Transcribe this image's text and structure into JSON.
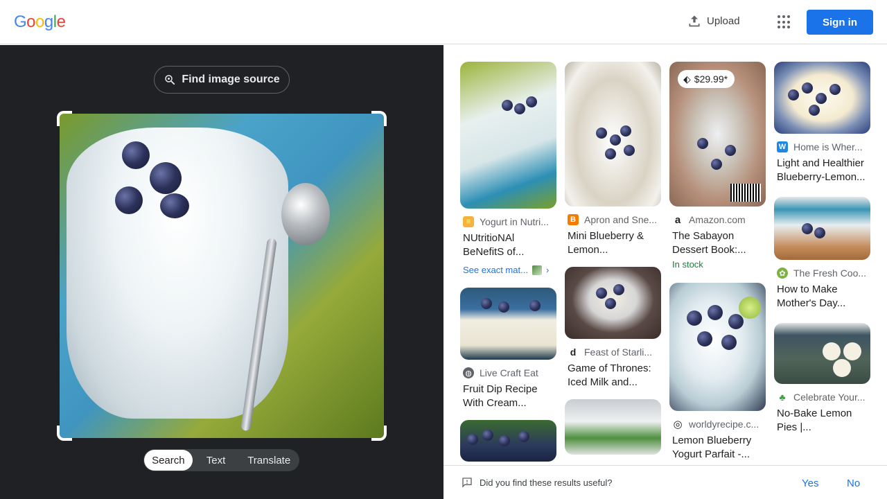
{
  "header": {
    "logo_letters": [
      {
        "ch": "G",
        "color": "#4285F4"
      },
      {
        "ch": "o",
        "color": "#EA4335"
      },
      {
        "ch": "o",
        "color": "#FBBC05"
      },
      {
        "ch": "g",
        "color": "#4285F4"
      },
      {
        "ch": "l",
        "color": "#34A853"
      },
      {
        "ch": "e",
        "color": "#EA4335"
      }
    ],
    "upload_label": "Upload",
    "upload_icon": "upload-icon",
    "apps_icon": "apps-grid-icon",
    "signin_label": "Sign in"
  },
  "left_pane": {
    "find_source_label": "Find image source",
    "find_source_icon": "lens-search-icon",
    "modes": [
      {
        "label": "Search",
        "active": true
      },
      {
        "label": "Text",
        "active": false
      },
      {
        "label": "Translate",
        "active": false
      }
    ]
  },
  "results": {
    "columns": [
      [
        {
          "source": "Yogurt in Nutri...",
          "title": "NUtritioNAl BeNefitS of...",
          "exact_label": "See exact mat...",
          "icon_color": "#f3b33d",
          "icon_char": "≡"
        },
        {
          "source": "Live Craft Eat",
          "title": "Fruit Dip Recipe With Cream...",
          "icon_color": "#5f6368",
          "icon_char": "◍"
        },
        {
          "source": "",
          "title": ""
        }
      ],
      [
        {
          "source": "Apron and Sne...",
          "title": "Mini Blueberry & Lemon...",
          "icon_color": "#f57c00",
          "icon_char": "B"
        },
        {
          "source": "Feast of Starli...",
          "title": "Game of Thrones: Iced Milk and...",
          "icon_color": "#202124",
          "icon_char": "d"
        },
        {
          "source": "",
          "title": ""
        }
      ],
      [
        {
          "source": "Amazon.com",
          "title": "The Sabayon Dessert Book:...",
          "price": "$29.99*",
          "stock": "In stock",
          "icon_color": "#202124",
          "icon_char": "a"
        },
        {
          "source": "worldyrecipe.c...",
          "title": "Lemon Blueberry Yogurt Parfait -...",
          "icon_color": "#202124",
          "icon_char": "◎"
        }
      ],
      [
        {
          "source": "Home is Wher...",
          "title": "Light and Healthier Blueberry-Lemon...",
          "icon_color": "#1e88e5",
          "icon_char": "W"
        },
        {
          "source": "The Fresh Coo...",
          "title": "How to Make Mother's Day...",
          "icon_color": "#7cb342",
          "icon_char": "✿"
        },
        {
          "source": "Celebrate Your...",
          "title": "No-Bake Lemon Pies |...",
          "icon_color": "#43a047",
          "icon_char": "♣"
        }
      ]
    ]
  },
  "feedback": {
    "question": "Did you find these results useful?",
    "yes_label": "Yes",
    "no_label": "No"
  }
}
